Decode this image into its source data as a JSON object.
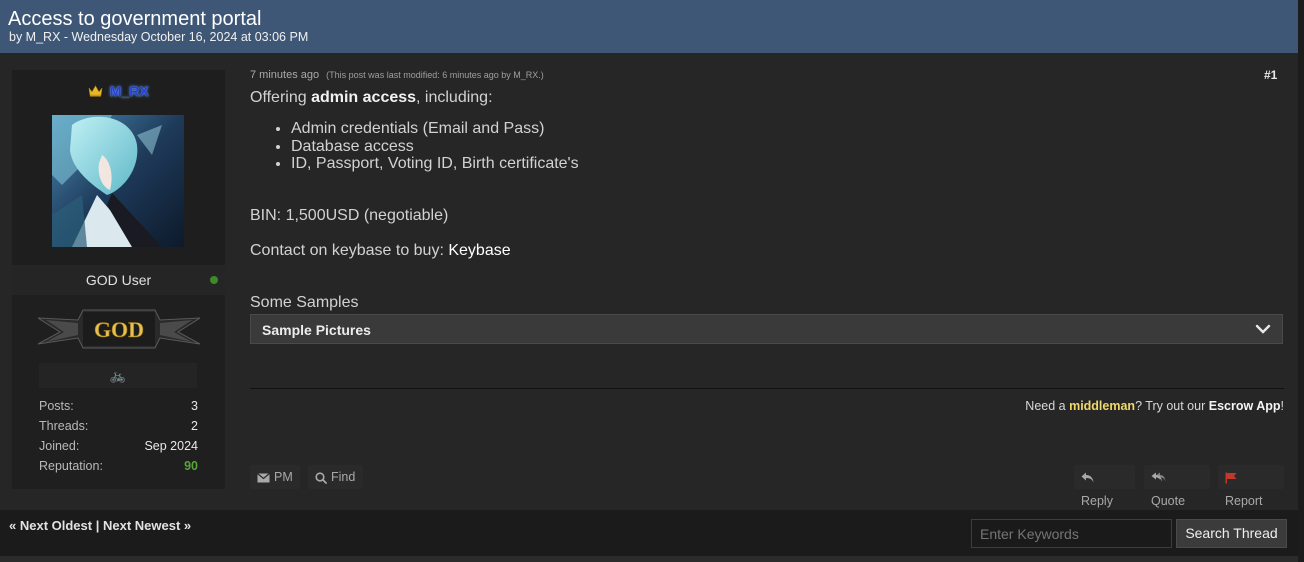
{
  "thread": {
    "title": "Access to government portal",
    "byline": "by M_RX - Wednesday October 16, 2024 at 03:06 PM"
  },
  "user": {
    "name": "M_RX",
    "rank": "GOD User",
    "banner_text": "GOD",
    "stats": [
      {
        "key": "Posts:",
        "value": "3"
      },
      {
        "key": "Threads:",
        "value": "2"
      },
      {
        "key": "Joined:",
        "value": "Sep 2024"
      },
      {
        "key": "Reputation:",
        "value": "90"
      }
    ]
  },
  "post": {
    "time": "7 minutes ago",
    "modified": "(This post was last modified: 6 minutes ago by M_RX.)",
    "number": "#1",
    "intro_pre": "Offering ",
    "intro_bold": "admin access",
    "intro_post": ", including:",
    "features": [
      "Admin credentials (Email and Pass)",
      "Database access",
      "ID, Passport, Voting ID, Birth certificate's"
    ],
    "bin": "BIN: 1,500USD (negotiable)",
    "contact_pre": "Contact on keybase to buy: ",
    "contact_link": "Keybase",
    "samples_heading": "Some Samples",
    "spoiler_label": "Sample Pictures"
  },
  "escrow": {
    "pre": "Need a ",
    "highlight": "middleman",
    "mid": "? Try out our ",
    "app": "Escrow App",
    "end": "!"
  },
  "actions": {
    "pm": "PM",
    "find": "Find",
    "reply": "Reply",
    "quote": "Quote",
    "report": "Report"
  },
  "footer": {
    "next_oldest": "« Next Oldest",
    "separator": "|",
    "next_newest": "Next Newest »",
    "search_placeholder": "Enter Keywords",
    "search_button": "Search Thread"
  },
  "colors": {
    "header": "#3f5776",
    "username": "#2a3bd8",
    "reputation": "#56a43a",
    "escrow_highlight": "#f0d86a",
    "report_flag": "#c0392b"
  }
}
